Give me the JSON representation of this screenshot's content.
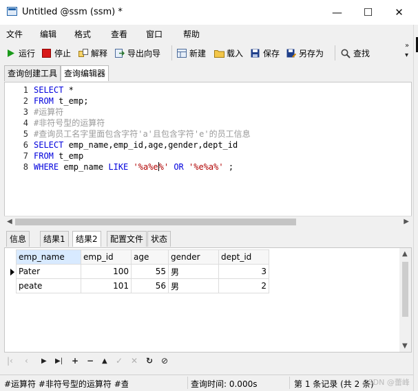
{
  "window": {
    "title": "Untitled @ssm (ssm) *",
    "minimize_glyph": "—",
    "maximize_glyph": "☐",
    "close_glyph": "✕"
  },
  "menu": [
    "文件",
    "编辑",
    "格式",
    "查看",
    "窗口",
    "帮助"
  ],
  "toolbar": {
    "run": "运行",
    "stop": "停止",
    "explain": "解释",
    "export_wizard": "导出向导",
    "new": "新建",
    "load": "载入",
    "save": "保存",
    "save_as": "另存为",
    "find": "查找",
    "overflow": "»",
    "overflow_arrow": "▾"
  },
  "editor_tabs": [
    "查询创建工具",
    "查询编辑器"
  ],
  "code_lines": [
    {
      "n": "1",
      "tokens": [
        {
          "t": "SELECT",
          "c": "kw"
        },
        {
          "t": " *",
          "c": ""
        }
      ]
    },
    {
      "n": "2",
      "tokens": [
        {
          "t": "FROM",
          "c": "kw"
        },
        {
          "t": " t_emp;",
          "c": ""
        }
      ]
    },
    {
      "n": "3",
      "tokens": [
        {
          "t": "#运算符",
          "c": "cm"
        }
      ]
    },
    {
      "n": "4",
      "tokens": [
        {
          "t": "#非符号型的运算符",
          "c": "cm"
        }
      ]
    },
    {
      "n": "5",
      "tokens": [
        {
          "t": "#查询员工名字里面包含字符'a'且包含字符'e'的员工信息",
          "c": "cm"
        }
      ]
    },
    {
      "n": "6",
      "tokens": [
        {
          "t": "SELECT",
          "c": "kw"
        },
        {
          "t": " emp_name,emp_id,age,gender,dept_id",
          "c": ""
        }
      ]
    },
    {
      "n": "7",
      "tokens": [
        {
          "t": "FROM",
          "c": "kw"
        },
        {
          "t": " t_emp",
          "c": ""
        }
      ]
    },
    {
      "n": "8",
      "tokens": [
        {
          "t": "WHERE",
          "c": "kw"
        },
        {
          "t": " emp_name ",
          "c": ""
        },
        {
          "t": "LIKE",
          "c": "kw"
        },
        {
          "t": " ",
          "c": ""
        },
        {
          "t": "'%a%e",
          "c": "st"
        },
        {
          "t": "|caret|",
          "c": "caret"
        },
        {
          "t": "%'",
          "c": "st"
        },
        {
          "t": " ",
          "c": ""
        },
        {
          "t": "OR",
          "c": "kw"
        },
        {
          "t": " ",
          "c": ""
        },
        {
          "t": "'%e%a%'",
          "c": "st"
        },
        {
          "t": " ;",
          "c": ""
        }
      ]
    }
  ],
  "result_tabs": [
    "信息",
    "结果1",
    "结果2",
    "配置文件",
    "状态"
  ],
  "grid": {
    "columns": [
      "emp_name",
      "emp_id",
      "age",
      "gender",
      "dept_id"
    ],
    "rows": [
      [
        "Pater",
        "100",
        "55",
        "男",
        "3"
      ],
      [
        "peate",
        "101",
        "56",
        "男",
        "2"
      ]
    ]
  },
  "nav_buttons": [
    "|‹",
    "‹",
    "▶",
    "▶|",
    "+",
    "−",
    "▲",
    "✓",
    "✕",
    "↻",
    "⊘"
  ],
  "status": {
    "sql": "#运算符 #非符号型的运算符 #查询",
    "query_time": "查询时间: 0.000s",
    "record": "第 1 条记录 (共 2 条)"
  },
  "watermark": "CSDN @蕾峰"
}
